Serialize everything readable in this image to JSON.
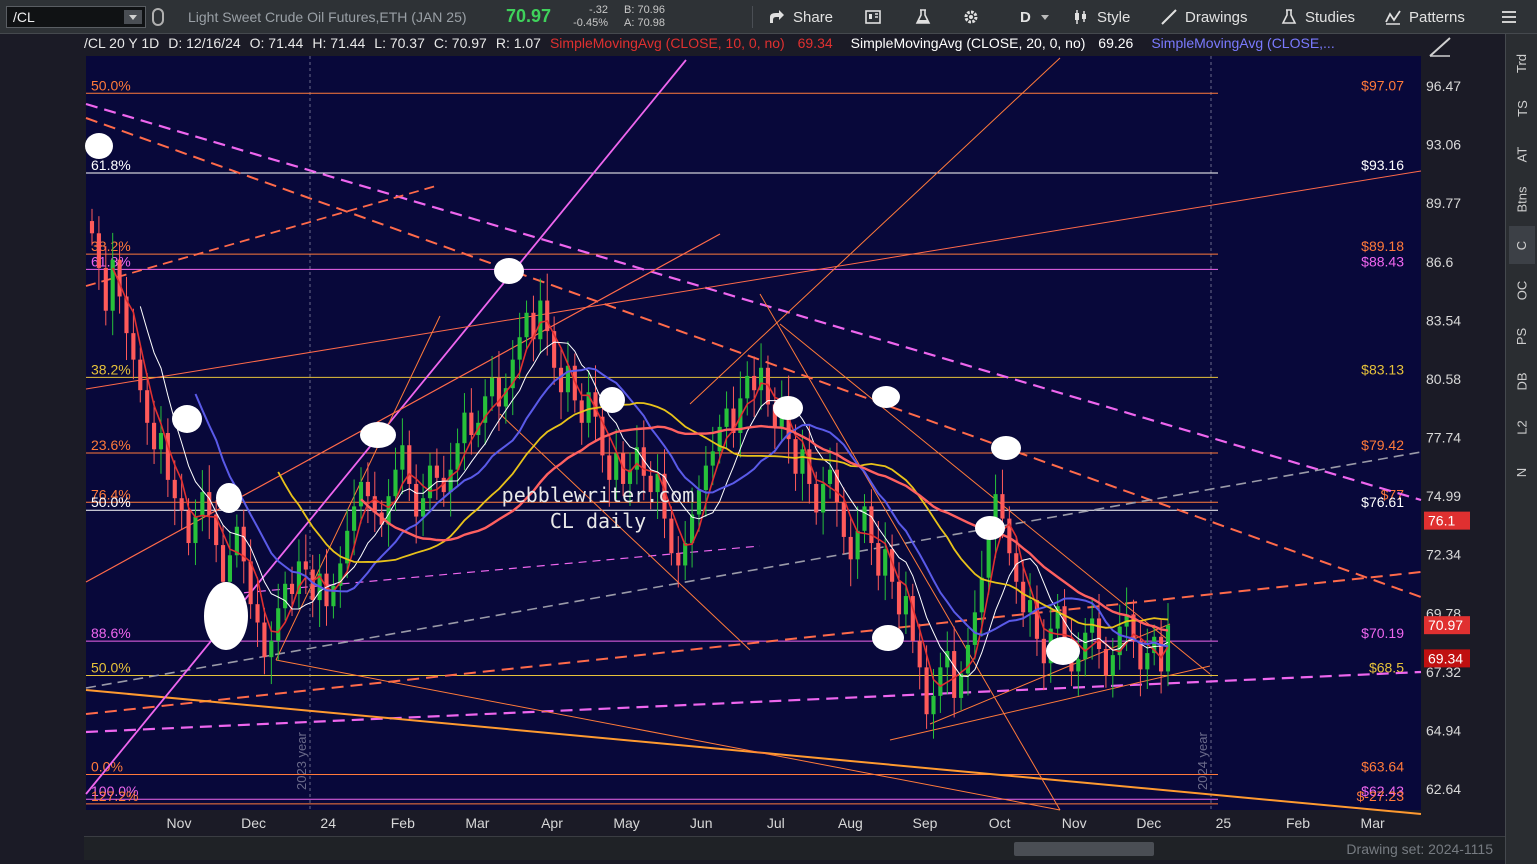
{
  "toolbar": {
    "symbol": "/CL",
    "description": "Light Sweet Crude Oil Futures,ETH (JAN 25)",
    "last": "70.97",
    "change": "-.32",
    "change_pct": "-0.45%",
    "bid": "B: 70.96",
    "ask": "A: 70.98",
    "share": "Share",
    "period": "D",
    "style": "Style",
    "drawings": "Drawings",
    "studies": "Studies",
    "patterns": "Patterns"
  },
  "info": {
    "period": "/CL 20 Y 1D",
    "date": "D: 12/16/24",
    "open": "O: 71.44",
    "high": "H: 71.44",
    "low": "L: 70.37",
    "close": "C: 70.97",
    "range": "R: 1.07",
    "sma10": "SimpleMovingAvg (CLOSE, 10, 0, no)",
    "sma10_val": "69.34",
    "sma20": "SimpleMovingAvg (CLOSE, 20, 0, no)",
    "sma20_val": "69.26",
    "sma_more": "SimpleMovingAvg (CLOSE,..."
  },
  "side_tabs": [
    "Trd",
    "TS",
    "AT",
    "Btns",
    "C",
    "OC",
    "PS",
    "DB",
    "L2",
    "N"
  ],
  "watermark": [
    "pebblewriter.com",
    "CL daily"
  ],
  "drawing_set": "Drawing set: 2024-1115",
  "colors": {
    "bg": "#08083a",
    "up": "#27c13a",
    "down": "#ff5a5a",
    "sma10": "#e03030",
    "sma20": "#ffffff",
    "sma50": "#5a5ae8",
    "sma100": "#e8c21a",
    "sma200": "#ff6060",
    "fib_yellow": "#e6c23a",
    "fib_orange": "#ff7a3a",
    "fib_pink": "#ee66ee"
  },
  "chart_data": {
    "type": "candlestick",
    "y_ticks": [
      "96.47",
      "93.06",
      "89.77",
      "86.6",
      "83.54",
      "80.58",
      "77.74",
      "74.99",
      "72.34",
      "69.78",
      "67.32",
      "64.94",
      "62.64"
    ],
    "x_ticks": [
      "Nov",
      "Dec",
      "24",
      "Feb",
      "Mar",
      "Apr",
      "May",
      "Jun",
      "Jul",
      "Aug",
      "Sep",
      "Oct",
      "Nov",
      "Dec",
      "25",
      "Feb",
      "Mar"
    ],
    "year_markers": [
      "2023 year",
      "2024 year"
    ],
    "ylim": [
      61.9,
      98.9
    ],
    "price_labels": [
      {
        "text": "76.1",
        "value": 76.1,
        "color": "#e03030"
      },
      {
        "text": "70.97",
        "value": 70.97,
        "color": "#e03030"
      },
      {
        "text": "69.34",
        "value": 69.34,
        "color": "#c01010"
      }
    ],
    "fib_levels": [
      {
        "value": 97.07,
        "left": "50.0%",
        "right": "$97.07",
        "color": "#ff7a3a"
      },
      {
        "value": 93.16,
        "left": "61.8%",
        "right": "$93.16",
        "color": "#ffffff"
      },
      {
        "value": 89.18,
        "left": "38.2%",
        "right": "$89.18",
        "color": "#ff7a3a"
      },
      {
        "value": 88.43,
        "left": "61.8%",
        "right": "$88.43",
        "color": "#ee66ee"
      },
      {
        "value": 83.13,
        "left": "38.2%",
        "right": "$83.13",
        "color": "#e6c23a"
      },
      {
        "value": 79.42,
        "left": "23.6%",
        "right": "$79.42",
        "color": "#ff7a3a"
      },
      {
        "value": 77.0,
        "left": "76.4%",
        "right": "$77",
        "color": "#ff7a3a"
      },
      {
        "value": 76.61,
        "left": "50.0%",
        "right": "$76.61",
        "color": "#ffffff"
      },
      {
        "value": 70.19,
        "left": "88.6%",
        "right": "$70.19",
        "color": "#ee66ee"
      },
      {
        "value": 68.5,
        "left": "50.0%",
        "right": "$68.5",
        "color": "#e6c23a"
      },
      {
        "value": 63.64,
        "left": "0.0%",
        "right": "$63.64",
        "color": "#ff7a3a"
      },
      {
        "value": 62.43,
        "left": "100.0%",
        "right": "$62.43",
        "color": "#ee66ee"
      },
      {
        "value": 62.2,
        "left": "127.2%",
        "right": "$-27.23",
        "color": "#ff7a3a"
      }
    ],
    "closes": [
      90.2,
      88.5,
      86.4,
      88.9,
      87.1,
      85.3,
      84.0,
      82.5,
      80.9,
      79.6,
      80.4,
      78.1,
      77.2,
      76.6,
      75.0,
      76.3,
      77.5,
      76.4,
      74.9,
      73.1,
      74.4,
      75.8,
      74.1,
      72.0,
      71.1,
      69.4,
      70.2,
      71.8,
      73.0,
      72.5,
      74.1,
      73.7,
      72.2,
      73.5,
      71.9,
      72.9,
      74.0,
      75.6,
      76.8,
      78.0,
      77.3,
      76.5,
      75.9,
      77.3,
      78.6,
      79.8,
      77.9,
      76.3,
      77.2,
      78.8,
      78.2,
      77.5,
      78.6,
      79.9,
      81.4,
      80.3,
      80.9,
      82.2,
      83.1,
      81.7,
      82.6,
      84.0,
      85.1,
      86.3,
      85.0,
      86.9,
      85.4,
      83.6,
      82.4,
      83.7,
      82.0,
      80.9,
      82.4,
      81.2,
      79.3,
      78.1,
      79.4,
      77.9,
      78.6,
      79.7,
      78.3,
      77.5,
      78.4,
      76.2,
      74.5,
      73.9,
      75.0,
      76.4,
      77.6,
      78.8,
      79.5,
      80.7,
      81.6,
      80.4,
      82.1,
      83.2,
      82.5,
      83.6,
      81.8,
      80.7,
      81.9,
      80.1,
      78.4,
      79.6,
      77.9,
      76.5,
      77.9,
      78.6,
      77.0,
      75.3,
      74.2,
      75.6,
      76.8,
      75.0,
      73.4,
      74.7,
      73.1,
      71.5,
      72.4,
      70.2,
      68.9,
      66.6,
      67.5,
      68.9,
      69.7,
      67.4,
      68.6,
      70.0,
      71.6,
      73.3,
      75.6,
      77.4,
      76.2,
      74.5,
      73.1,
      71.6,
      72.2,
      70.3,
      69.1,
      70.8,
      71.9,
      70.2,
      68.7,
      69.3,
      70.6,
      71.3,
      69.8,
      68.5,
      69.5,
      70.9,
      71.5,
      70.2,
      68.8,
      69.6,
      70.4,
      68.7,
      70.97
    ]
  }
}
